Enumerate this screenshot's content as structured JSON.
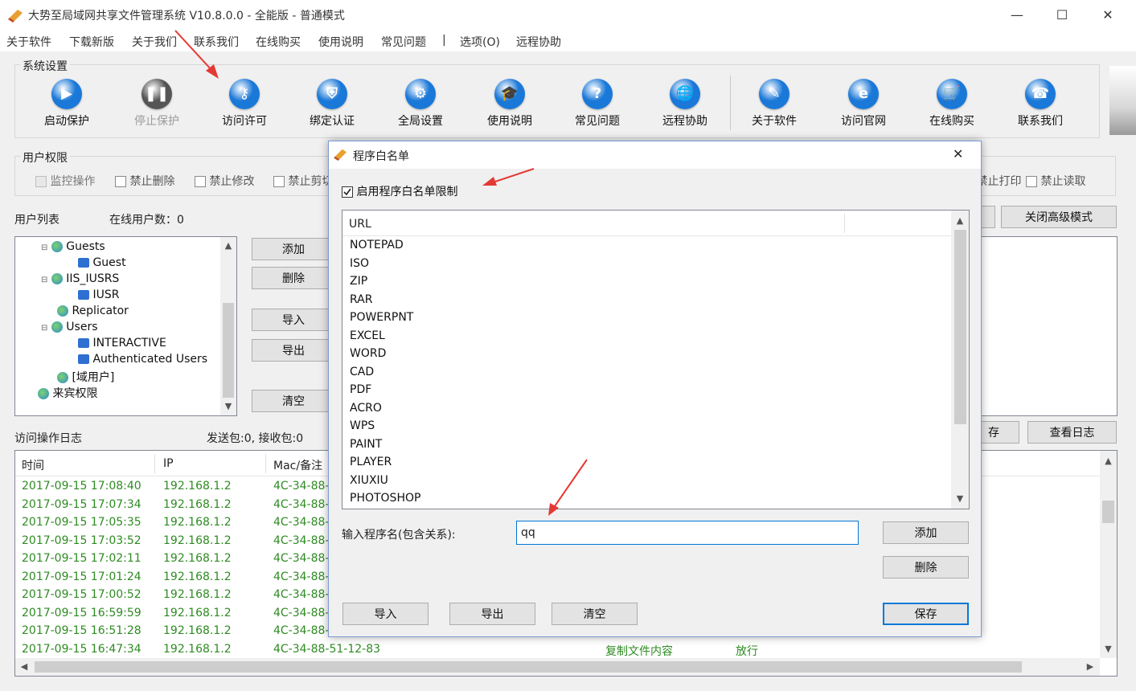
{
  "window": {
    "title": "大势至局域网共享文件管理系统 V10.8.0.0 - 全能版 - 普通模式",
    "minimize": "—",
    "maximize": "☐",
    "close": "✕"
  },
  "menu": [
    "关于软件",
    "下载新版",
    "关于我们",
    "联系我们",
    "在线购买",
    "使用说明",
    "常见问题",
    "|",
    "选项(O)",
    "远程协助"
  ],
  "system_settings": {
    "legend": "系统设置",
    "buttons": [
      {
        "label": "启动保护",
        "icon": "play-icon",
        "color": "#1a78d8",
        "glyph": "▶"
      },
      {
        "label": "停止保护",
        "icon": "pause-icon",
        "color": "#555555",
        "glyph": "❚❚"
      },
      {
        "label": "访问许可",
        "icon": "key-icon",
        "color": "#1a78d8",
        "glyph": "⚷"
      },
      {
        "label": "绑定认证",
        "icon": "shield-icon",
        "color": "#1a78d8",
        "glyph": "⛨"
      },
      {
        "label": "全局设置",
        "icon": "gear-icon",
        "color": "#1a78d8",
        "glyph": "⚙"
      },
      {
        "label": "使用说明",
        "icon": "graduation-cap-icon",
        "color": "#1a78d8",
        "glyph": "🎓"
      },
      {
        "label": "常见问题",
        "icon": "question-icon",
        "color": "#1a78d8",
        "glyph": "?"
      },
      {
        "label": "远程协助",
        "icon": "globe-icon",
        "color": "#1a78d8",
        "glyph": "🌐"
      },
      {
        "label": "关于软件",
        "icon": "edit-icon",
        "color": "#1a78d8",
        "glyph": "✎"
      },
      {
        "label": "访问官网",
        "icon": "ie-icon",
        "color": "#1a78d8",
        "glyph": "e"
      },
      {
        "label": "在线购买",
        "icon": "cart-icon",
        "color": "#1a78d8",
        "glyph": "🛒"
      },
      {
        "label": "联系我们",
        "icon": "phone-icon",
        "color": "#1a78d8",
        "glyph": "☎"
      }
    ]
  },
  "user_permissions": {
    "legend": "用户权限",
    "left_items": [
      "监控操作",
      "禁止删除",
      "禁止修改",
      "禁止剪切"
    ],
    "right_items": [
      "禁止打印",
      "禁止读取"
    ]
  },
  "user_list": {
    "label": "用户列表",
    "online_label": "在线用户数：0",
    "tree": [
      "Guests",
      "Guest",
      "IIS_IUSRS",
      "IUSR",
      "Replicator",
      "Users",
      "INTERACTIVE",
      "Authenticated Users",
      "[域用户]",
      "来宾权限"
    ],
    "buttons": [
      "添加",
      "删除",
      "导入",
      "导出",
      "清空"
    ],
    "close_advanced": "关闭高级模式"
  },
  "access_log": {
    "label": "访问操作日志",
    "packets": "发送包:0, 接收包:0",
    "columns": [
      "时间",
      "IP",
      "Mac/备注"
    ],
    "rows": [
      {
        "time": "2017-09-15 17:08:40",
        "ip": "192.168.1.2",
        "mac": "4C-34-88-"
      },
      {
        "time": "2017-09-15 17:07:34",
        "ip": "192.168.1.2",
        "mac": "4C-34-88-"
      },
      {
        "time": "2017-09-15 17:05:35",
        "ip": "192.168.1.2",
        "mac": "4C-34-88-"
      },
      {
        "time": "2017-09-15 17:03:52",
        "ip": "192.168.1.2",
        "mac": "4C-34-88-"
      },
      {
        "time": "2017-09-15 17:02:11",
        "ip": "192.168.1.2",
        "mac": "4C-34-88-"
      },
      {
        "time": "2017-09-15 17:01:24",
        "ip": "192.168.1.2",
        "mac": "4C-34-88-"
      },
      {
        "time": "2017-09-15 17:00:52",
        "ip": "192.168.1.2",
        "mac": "4C-34-88-"
      },
      {
        "time": "2017-09-15 16:59:59",
        "ip": "192.168.1.2",
        "mac": "4C-34-88-"
      },
      {
        "time": "2017-09-15 16:51:28",
        "ip": "192.168.1.2",
        "mac": "4C-34-88-"
      },
      {
        "time": "2017-09-15 16:47:34",
        "ip": "192.168.1.2",
        "mac": "4C-34-88-51-12-83",
        "op": "复制文件内容",
        "result": "放行"
      }
    ],
    "save_partial": "存",
    "view_log": "查看日志"
  },
  "dialog": {
    "title": "程序白名单",
    "close": "✕",
    "enable_label": "启用程序白名单限制",
    "enable_checked": true,
    "column": "URL",
    "items": [
      "NOTEPAD",
      "ISO",
      "ZIP",
      "RAR",
      "POWERPNT",
      "EXCEL",
      "WORD",
      "CAD",
      "PDF",
      "ACRO",
      "WPS",
      "PAINT",
      "PLAYER",
      "XIUXIU",
      "PHOTOSHOP"
    ],
    "input_label": "输入程序名(包含关系):",
    "input_value": "qq",
    "add": "添加",
    "delete": "删除",
    "import": "导入",
    "export": "导出",
    "clear": "清空",
    "save": "保存"
  }
}
